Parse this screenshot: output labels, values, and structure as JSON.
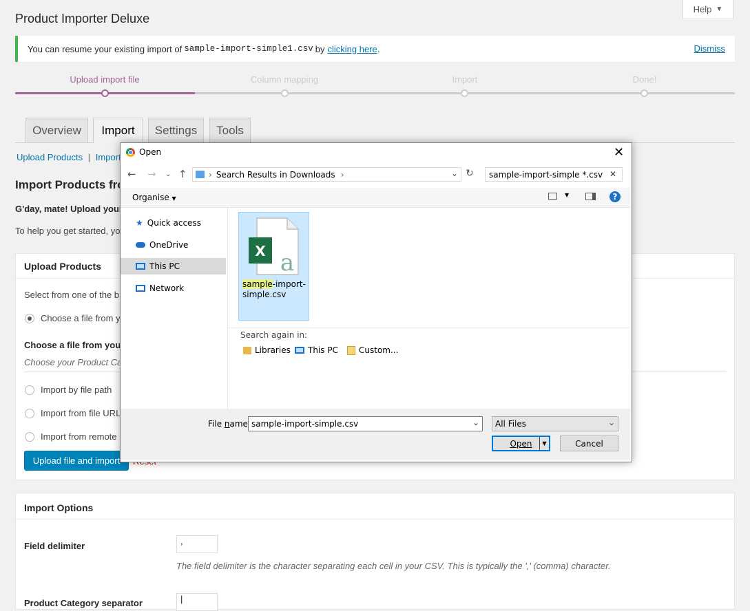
{
  "page": {
    "title": "Product Importer Deluxe",
    "help_label": "Help",
    "notice": {
      "prefix": "You can resume your existing import of",
      "filename": "sample-import-simple1.csv",
      "by": "by",
      "link": "clicking here",
      "suffix": ".",
      "dismiss": "Dismiss"
    },
    "steps": [
      "Upload import file",
      "Column mapping",
      "Import",
      "Done!"
    ],
    "tabs": [
      "Overview",
      "Import",
      "Settings",
      "Tools"
    ],
    "sublinks": {
      "upload": "Upload Products",
      "sep": "|",
      "import": "Import"
    },
    "heading": "Import Products fro",
    "intro_bold": "G'day, mate! Upload your",
    "intro_text": "To help you get started, yo",
    "upload_box": {
      "title": "Upload Products",
      "select_text": "Select from one of the b",
      "opt_choose": "Choose a file from y",
      "choose_heading": "Choose a file from your",
      "choose_hint": "Choose your Product Ca",
      "opt_path": "Import by file path",
      "opt_url": "Import from file URL",
      "opt_remote": "Import from remote",
      "upload_button": "Upload file and import",
      "reset": "Reset"
    },
    "options_box": {
      "title": "Import Options",
      "delimiter_label": "Field delimiter",
      "delimiter_value": ",",
      "delimiter_desc": "The field delimiter is the character separating each cell in your CSV. This is typically the ',' (comma) character.",
      "category_label": "Product Category separator",
      "category_value": "|"
    }
  },
  "dialog": {
    "title": "Open",
    "breadcrumb": "Search Results in Downloads",
    "search_value": "sample-import-simple *.csv",
    "organise": "Organise",
    "nav": [
      "Quick access",
      "OneDrive",
      "This PC",
      "Network"
    ],
    "file": {
      "highlight": "sample",
      "rest1": "-import-",
      "rest2": "simple.csv"
    },
    "search_again": "Search again in:",
    "search_targets": [
      "Libraries",
      "This PC",
      "Custom..."
    ],
    "filename_label_pre": "File ",
    "filename_label_u": "n",
    "filename_label_post": "ame:",
    "filename_value": "sample-import-simple.csv",
    "filter": "All Files",
    "open_button": "Open",
    "cancel_button": "Cancel"
  },
  "colors": {
    "accent": "#a46497",
    "primary": "#0085ba",
    "notice": "#46b450",
    "selection": "#cce8ff"
  }
}
